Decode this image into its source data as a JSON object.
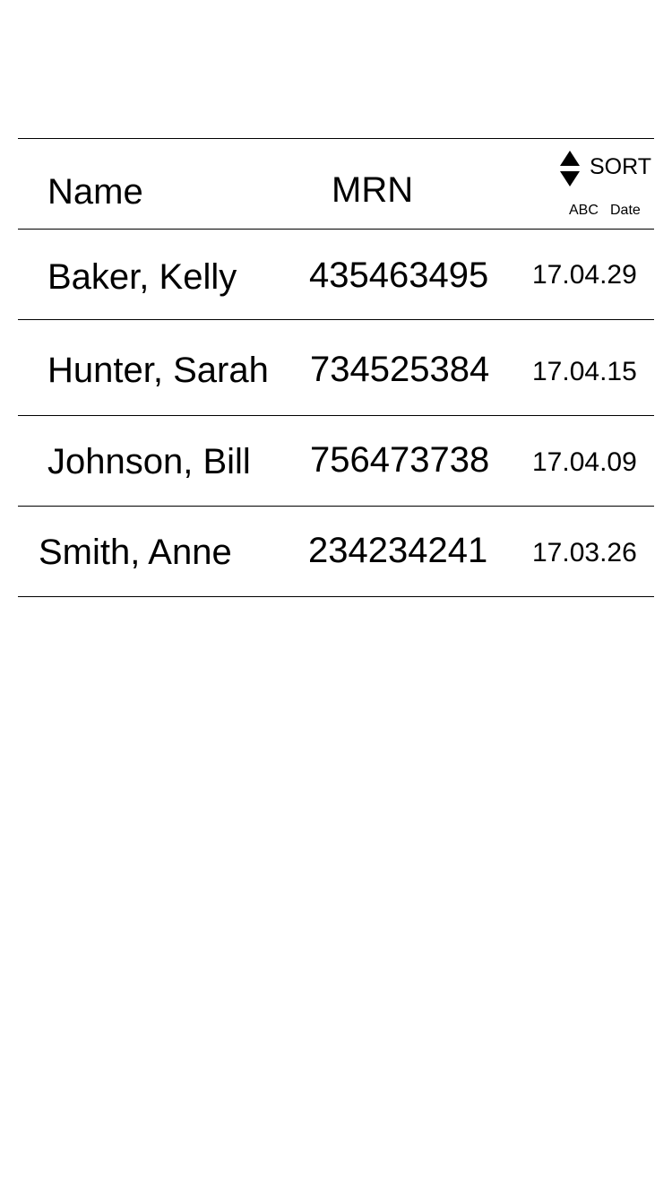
{
  "header": {
    "name_label": "Name",
    "mrn_label": "MRN",
    "sort_label": "SORT",
    "sort_options": [
      "ABC",
      "Date"
    ]
  },
  "icons": {
    "sort": "sort-up-down-icon"
  },
  "rows": [
    {
      "name": "Baker, Kelly",
      "mrn": "435463495",
      "date": "17.04.29"
    },
    {
      "name": "Hunter, Sarah",
      "mrn": "734525384",
      "date": "17.04.15"
    },
    {
      "name": "Johnson, Bill",
      "mrn": "756473738",
      "date": "17.04.09"
    },
    {
      "name": "Smith, Anne",
      "mrn": "234234241",
      "date": "17.03.26"
    }
  ]
}
